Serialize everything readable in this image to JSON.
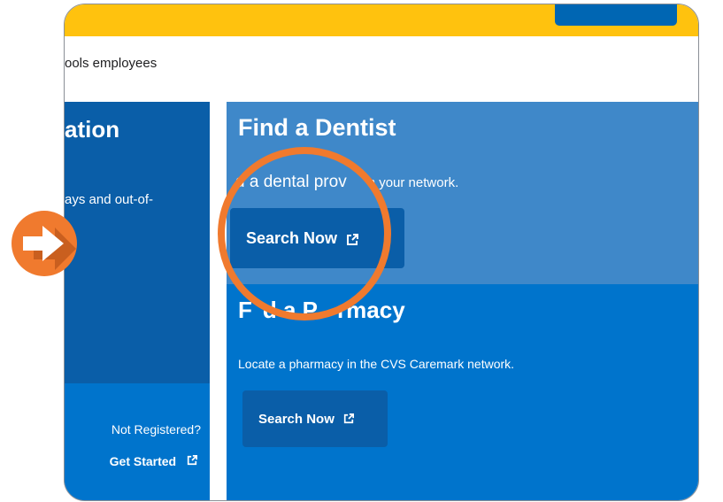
{
  "header": {
    "subtitle": "ools employees"
  },
  "left_panel": {
    "title": "ation",
    "text": "ays and out-of-",
    "not_registered": "Not Registered?",
    "get_started": "Get Started"
  },
  "dentist_card": {
    "title": "Find a Dentist",
    "desc_part1": "d a dental prov",
    "desc_part2": "n your network.",
    "button_label": "Search Now"
  },
  "pharmacy_card": {
    "title_left": "F",
    "title_mid": "d a P",
    "title_right": "rmacy",
    "desc": "Locate a pharmacy in the CVS Caremark network.",
    "button_label": "Search Now"
  },
  "colors": {
    "topbar": "#ffc20e",
    "dark_blue": "#0a5ea8",
    "mid_blue": "#0074cc",
    "light_blue": "#3f88c9",
    "annotation_orange": "#f07a2e"
  },
  "icons": {
    "external_link": "external-link-icon",
    "play_marker": "play-arrow-icon"
  }
}
